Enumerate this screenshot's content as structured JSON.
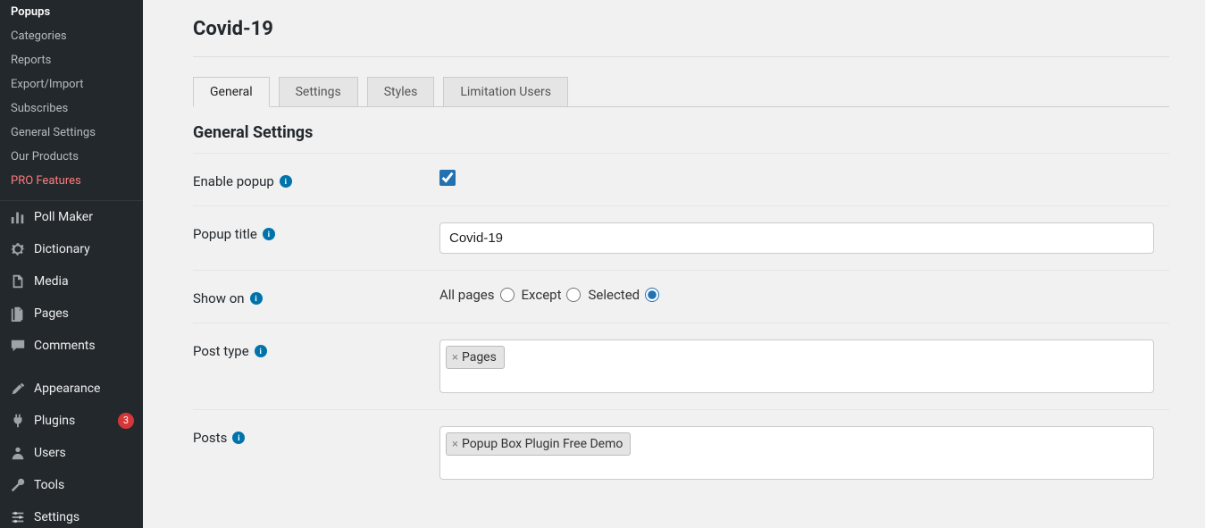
{
  "submenu": {
    "items": [
      {
        "label": "Popups",
        "current": true
      },
      {
        "label": "Categories"
      },
      {
        "label": "Reports"
      },
      {
        "label": "Export/Import"
      },
      {
        "label": "Subscribes"
      },
      {
        "label": "General Settings"
      },
      {
        "label": "Our Products"
      },
      {
        "label": "PRO Features",
        "pro": true
      }
    ]
  },
  "mainmenu": {
    "items": [
      {
        "label": "Poll Maker",
        "icon": "poll"
      },
      {
        "label": "Dictionary",
        "icon": "gear"
      },
      {
        "label": "Media",
        "icon": "media"
      },
      {
        "label": "Pages",
        "icon": "pages"
      },
      {
        "label": "Comments",
        "icon": "comments"
      },
      {
        "spacer": true
      },
      {
        "label": "Appearance",
        "icon": "appearance"
      },
      {
        "label": "Plugins",
        "icon": "plugins",
        "badge": "3"
      },
      {
        "label": "Users",
        "icon": "users"
      },
      {
        "label": "Tools",
        "icon": "tools"
      },
      {
        "label": "Settings",
        "icon": "settings"
      }
    ]
  },
  "page": {
    "title": "Covid-19"
  },
  "tabs": [
    {
      "label": "General",
      "active": true
    },
    {
      "label": "Settings"
    },
    {
      "label": "Styles"
    },
    {
      "label": "Limitation Users"
    }
  ],
  "section": {
    "title": "General Settings"
  },
  "fields": {
    "enable": {
      "label": "Enable popup",
      "checked": true
    },
    "title": {
      "label": "Popup title",
      "value": "Covid-19"
    },
    "show_on": {
      "label": "Show on",
      "options": [
        {
          "label": "All pages",
          "value": "all"
        },
        {
          "label": "Except",
          "value": "except"
        },
        {
          "label": "Selected",
          "value": "selected",
          "checked": true
        }
      ]
    },
    "post_type": {
      "label": "Post type",
      "tags": [
        "Pages"
      ]
    },
    "posts": {
      "label": "Posts",
      "tags": [
        "Popup Box Plugin Free Demo"
      ]
    }
  },
  "info_glyph": "i"
}
